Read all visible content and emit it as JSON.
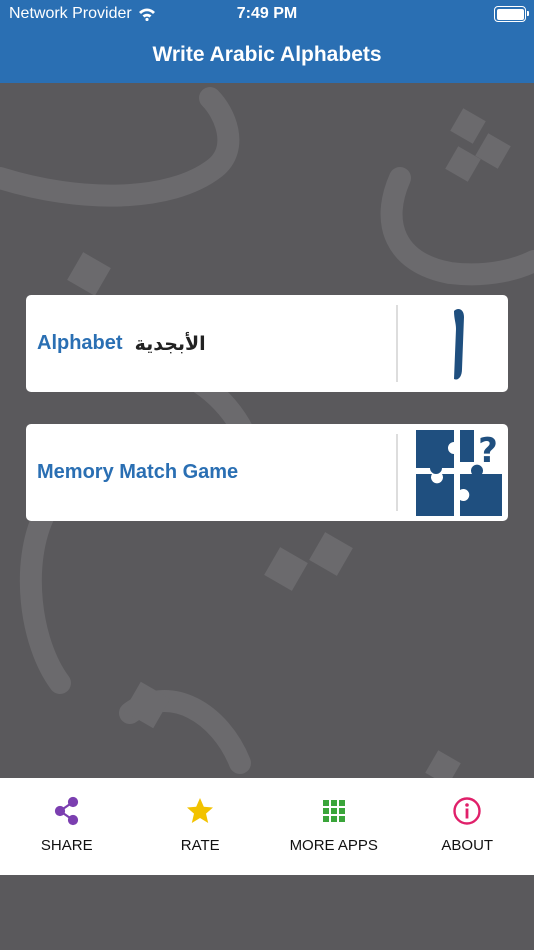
{
  "status": {
    "carrier": "Network Provider",
    "time": "7:49 PM"
  },
  "header": {
    "title": "Write Arabic Alphabets"
  },
  "cards": [
    {
      "label": "Alphabet",
      "arabic": "الأبجدية",
      "icon": "alif-letter-icon"
    },
    {
      "label": "Memory Match Game",
      "icon": "puzzle-question-icon"
    }
  ],
  "tabs": [
    {
      "label": "SHARE",
      "icon": "share-icon",
      "color": "#7b3fb0"
    },
    {
      "label": "RATE",
      "icon": "star-icon",
      "color": "#f2c200"
    },
    {
      "label": "MORE APPS",
      "icon": "grid-icon",
      "color": "#3aa53a"
    },
    {
      "label": "ABOUT",
      "icon": "info-icon",
      "color": "#e0206a"
    }
  ],
  "colors": {
    "header": "#2a6fb3",
    "background": "#5a595c",
    "card_icon": "#1f4f7f"
  }
}
